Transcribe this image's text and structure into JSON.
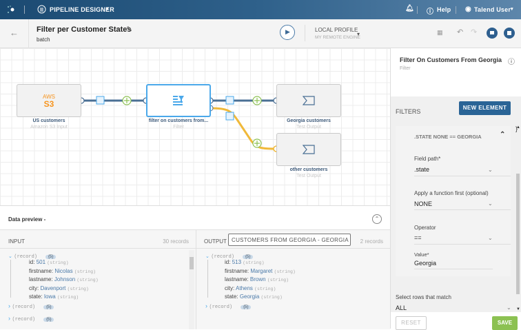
{
  "topbar": {
    "app": "PIPELINE DESIGNER",
    "help": "Help",
    "user": "Talend User"
  },
  "header": {
    "title": "Filter per Customer States",
    "subtitle": "batch",
    "profile": "LOCAL PROFILE",
    "engine": "MY REMOTE ENGINE"
  },
  "canvas": {
    "nodes": [
      {
        "name": "US customers",
        "type": "Amazon S3 Input",
        "logo_top": "AWS",
        "logo_bottom": "S3"
      },
      {
        "name": "filter on customers from...",
        "type": "Filter"
      },
      {
        "name": "Georgia customers",
        "type": "Test Output"
      },
      {
        "name": "other customers",
        "type": "Test Output"
      }
    ]
  },
  "preview": {
    "title": "Data preview -",
    "input_label": "INPUT",
    "input_count": "30 records",
    "output_label": "OUTPUT",
    "output_select": "CUSTOMERS FROM GEORGIA - GEORGIA CUS",
    "output_count": "2 records",
    "record": "(record)",
    "badge": "{5}",
    "type": "(string)",
    "input_fields": [
      {
        "k": "id:",
        "v": "501"
      },
      {
        "k": "firstname:",
        "v": "Nicolas"
      },
      {
        "k": "lastname:",
        "v": "Johnson"
      },
      {
        "k": "city:",
        "v": "Davenport"
      },
      {
        "k": "state:",
        "v": "Iowa"
      }
    ],
    "output_fields": [
      {
        "k": "id:",
        "v": "513"
      },
      {
        "k": "firstname:",
        "v": "Margaret"
      },
      {
        "k": "lastname:",
        "v": "Brown"
      },
      {
        "k": "city:",
        "v": "Athens"
      },
      {
        "k": "state:",
        "v": "Georgia"
      }
    ]
  },
  "panel": {
    "title": "Filter On Customers From Georgia",
    "subtitle": "Filter",
    "filters_label": "FILTERS",
    "new_element": "NEW ELEMENT",
    "filter_summary": ".STATE NONE == GEORGIA",
    "field_path_label": "Field path*",
    "field_path": ".state",
    "function_label": "Apply a function first (optional)",
    "function": "NONE",
    "operator_label": "Operator",
    "operator": "==",
    "value_label": "Value*",
    "value": "Georgia",
    "match_label": "Select rows that match",
    "match": "ALL",
    "reset": "RESET",
    "save": "SAVE"
  },
  "colors": {
    "accent": "#2a6496",
    "save": "#8cc152",
    "link_main": "#4a6f94",
    "link_reject": "#f0b93a"
  }
}
